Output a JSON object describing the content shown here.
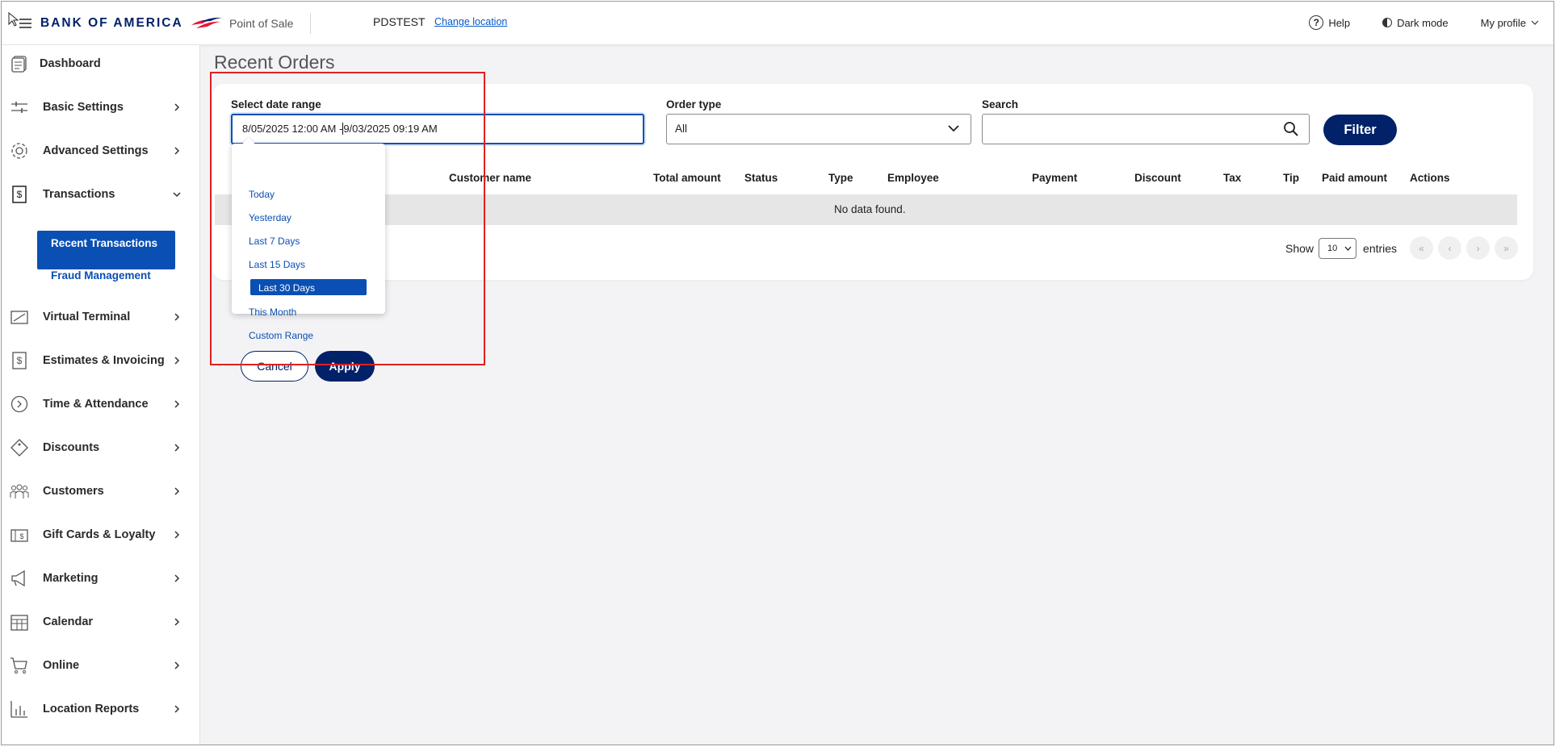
{
  "header": {
    "brand": "BANK OF AMERICA",
    "app_name": "Point of Sale",
    "location": "PDSTEST",
    "change_location": "Change location",
    "help": "Help",
    "dark_mode": "Dark mode",
    "profile": "My profile"
  },
  "sidebar": {
    "items": [
      {
        "label": "Dashboard",
        "icon": "dashboard-icon"
      },
      {
        "label": "Basic Settings",
        "icon": "sliders-icon"
      },
      {
        "label": "Advanced Settings",
        "icon": "gear-icon"
      },
      {
        "label": "Transactions",
        "icon": "dollar-doc-icon",
        "expanded": true
      },
      {
        "label": "Virtual Terminal",
        "icon": "terminal-icon"
      },
      {
        "label": "Estimates & Invoicing",
        "icon": "invoice-icon"
      },
      {
        "label": "Time & Attendance",
        "icon": "clock-icon"
      },
      {
        "label": "Discounts",
        "icon": "tag-icon"
      },
      {
        "label": "Customers",
        "icon": "people-icon"
      },
      {
        "label": "Gift Cards & Loyalty",
        "icon": "gift-card-icon"
      },
      {
        "label": "Marketing",
        "icon": "megaphone-icon"
      },
      {
        "label": "Calendar",
        "icon": "calendar-icon"
      },
      {
        "label": "Online",
        "icon": "cart-icon"
      },
      {
        "label": "Location Reports",
        "icon": "bar-chart-icon"
      }
    ],
    "transactions_sub": {
      "active": "Recent Transactions",
      "other": "Fraud Management"
    }
  },
  "main": {
    "title": "Recent Orders",
    "filters": {
      "date_label": "Select date range",
      "date_value_start": "8/05/2025 12:00 AM -",
      "date_value_end": "9/03/2025 09:19 AM",
      "order_type_label": "Order type",
      "order_type_value": "All",
      "search_label": "Search",
      "search_value": "",
      "filter_button": "Filter"
    },
    "table": {
      "columns": [
        "Customer name",
        "Total amount",
        "Status",
        "Type",
        "Employee",
        "Payment",
        "Discount",
        "Tax",
        "Tip",
        "Paid amount",
        "Actions"
      ],
      "empty_message": "No data found."
    },
    "pagination": {
      "show_label": "Show",
      "page_size": "10",
      "entries_label": "entries",
      "buttons": [
        "«",
        "‹",
        "›",
        "»"
      ]
    }
  },
  "date_dropdown": {
    "options": [
      "Today",
      "Yesterday",
      "Last 7 Days",
      "Last 15 Days",
      "Last 30 Days",
      "This Month",
      "Custom Range"
    ],
    "selected": "Last 30 Days",
    "cancel": "Cancel",
    "apply": "Apply"
  },
  "colors": {
    "brand_navy": "#012169",
    "accent_blue": "#0a4fb3",
    "highlight_red": "#e02020"
  }
}
